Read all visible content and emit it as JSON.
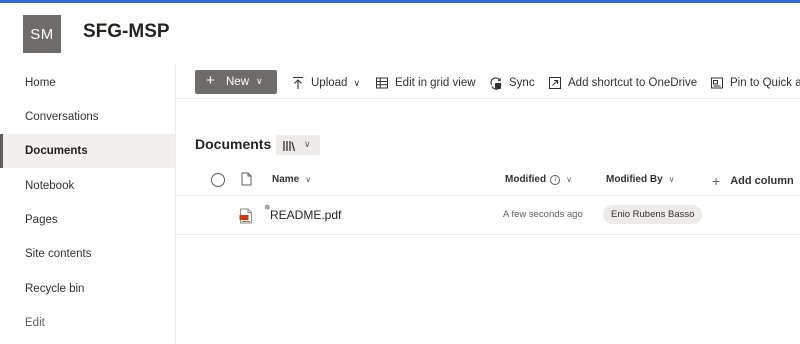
{
  "site": {
    "logo_initials": "SM",
    "title": "SFG-MSP",
    "accent": "#2b6fd6",
    "logo_bg": "#6e6c6a"
  },
  "sidebar": {
    "items": [
      {
        "label": "Home",
        "active": false
      },
      {
        "label": "Conversations",
        "active": false
      },
      {
        "label": "Documents",
        "active": true
      },
      {
        "label": "Notebook",
        "active": false
      },
      {
        "label": "Pages",
        "active": false
      },
      {
        "label": "Site contents",
        "active": false
      },
      {
        "label": "Recycle bin",
        "active": false
      },
      {
        "label": "Edit",
        "active": false
      }
    ]
  },
  "commandbar": {
    "new_label": "New",
    "upload_label": "Upload",
    "grid_label": "Edit in grid view",
    "sync_label": "Sync",
    "shortcut_label": "Add shortcut to OneDrive",
    "pin_label": "Pin to Quick a"
  },
  "library": {
    "title": "Documents",
    "view_icon": "library-icon"
  },
  "columns": {
    "name": "Name",
    "modified": "Modified",
    "modified_by": "Modified By",
    "add_column": "Add column"
  },
  "rows": [
    {
      "file_icon": "pdf-icon",
      "name": "README.pdf",
      "modified": "A few seconds ago",
      "modified_by": "Enio Rubens Basso"
    }
  ]
}
